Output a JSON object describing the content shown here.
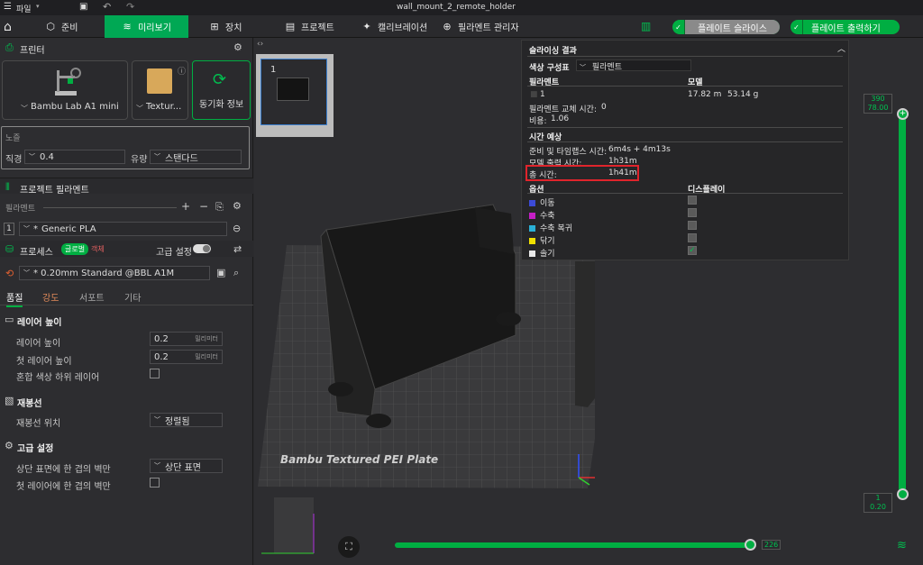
{
  "titlebar": {
    "menu_label": "파일",
    "title": "wall_mount_2_remote_holder"
  },
  "toolbar": {
    "tabs": [
      {
        "label": "준비",
        "icon": "cube-icon"
      },
      {
        "label": "미리보기",
        "icon": "layers-icon"
      },
      {
        "label": "장치",
        "icon": "device-icon"
      },
      {
        "label": "프로젝트",
        "icon": "project-icon"
      },
      {
        "label": "캘리브레이션",
        "icon": "calibration-icon"
      },
      {
        "label": "필라멘트 관리자",
        "icon": "filament-icon"
      }
    ],
    "slice_label": "플레이트 슬라이스",
    "print_label": "플레이트 출력하기"
  },
  "printer": {
    "section_title": "프린터",
    "printer_name": "Bambu Lab A1 mini",
    "plate_name": "Textur...",
    "sync_label": "동기화 정보",
    "nozzle_section": "노즐",
    "diameter_label": "직경",
    "diameter_value": "0.4",
    "flow_label": "유량",
    "flow_value": "스탠다드"
  },
  "filament": {
    "section_title": "프로젝트 필라멘트",
    "sub_label": "필라멘트",
    "slot_number": "1",
    "slot_value": "Generic PLA"
  },
  "process": {
    "section_title": "프로세스",
    "global_badge": "글로벌",
    "object_badge": "객체",
    "advanced_label": "고급 설정",
    "profile_value": "* 0.20mm Standard @BBL A1M",
    "tabs": [
      "품질",
      "강도",
      "서포트",
      "기타"
    ],
    "groups": [
      {
        "title": "레이어 높이",
        "icon": "layer-height-icon"
      },
      {
        "title": "재봉선",
        "icon": "seam-icon"
      },
      {
        "title": "고급 설정",
        "icon": "advanced-icon"
      }
    ],
    "layer_height_label": "레이어 높이",
    "layer_height_value": "0.2",
    "layer_height_unit": "밀리미터",
    "first_layer_label": "첫 레이어 높이",
    "first_layer_value": "0.2",
    "first_layer_unit": "밀리미터",
    "mixed_color_label": "혼합 색상 하위 레이어",
    "seam_position_label": "재봉선 위치",
    "seam_position_value": "정렬됨",
    "top_wall_label": "상단 표면에 한 겹의 벽만",
    "top_wall_value": "상단 표면",
    "first_wall_label": "첫 레이어에 한 겹의 벽만"
  },
  "viewport": {
    "plate_thumb_number": "1",
    "plate_text": "Bambu Textured PEI Plate",
    "top_slider_layer": "390",
    "top_slider_height": "78.00",
    "bottom_slider_layer": "1",
    "bottom_slider_height": "0.20",
    "horiz_slider_value": "226"
  },
  "results": {
    "title": "슬라이싱 결과",
    "color_scheme_label": "색상 구성표",
    "color_scheme_value": "필라멘트",
    "col_filament": "필라멘트",
    "col_model": "모델",
    "filament_id": "1",
    "model_length": "17.82 m",
    "model_weight": "53.14 g",
    "change_time_label": "필라멘트 교체 시간:",
    "change_time_value": "0",
    "cost_label": "비용:",
    "cost_value": "1.06",
    "time_section": "시간 예상",
    "prep_label": "준비 및 타임랩스 시간:",
    "prep_value": "6m4s + 4m13s",
    "model_print_label": "모델 출력 시간:",
    "model_print_value": "1h31m",
    "total_label": "총 시간:",
    "total_value": "1h41m",
    "options_label": "옵션",
    "display_label": "디스플레이",
    "options": [
      {
        "name": "이동",
        "color": "#3c4bd6",
        "checked": false
      },
      {
        "name": "수축",
        "color": "#c61fc6",
        "checked": false
      },
      {
        "name": "수축 복귀",
        "color": "#2ab0d6",
        "checked": false
      },
      {
        "name": "닦기",
        "color": "#f0e000",
        "checked": false
      },
      {
        "name": "솔기",
        "color": "#e8e8e8",
        "checked": true
      }
    ]
  },
  "colors": {
    "accent": "#00ae42",
    "highlight_box": "#e0242c"
  }
}
